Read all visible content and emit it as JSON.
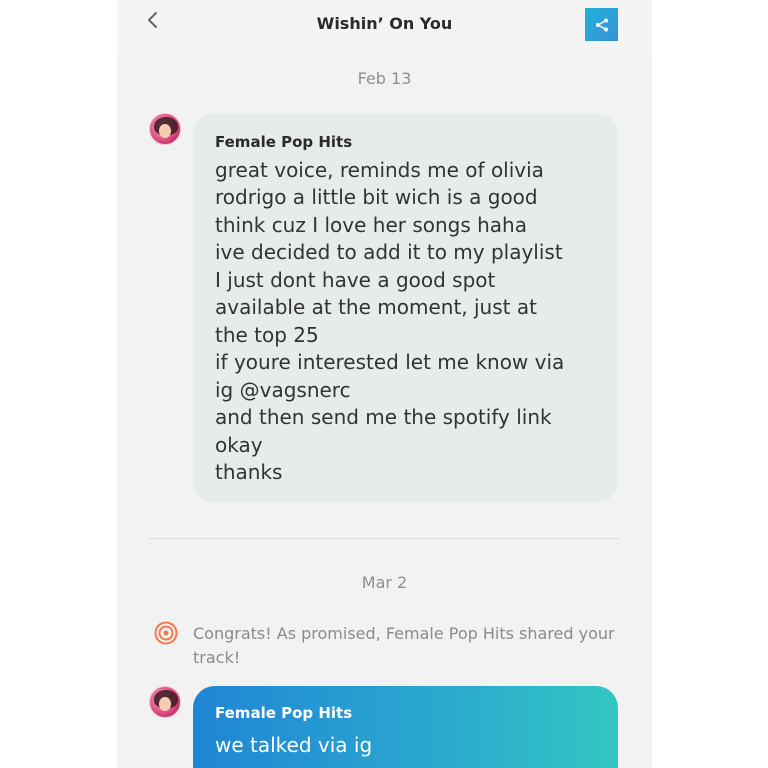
{
  "header": {
    "title": "Wishin’ On You"
  },
  "icons": {
    "back": "chevron-left-icon",
    "share": "share-icon",
    "congrats": "target-icon"
  },
  "colors": {
    "accent": "#2aa6cf",
    "share_button": "#2a9ed8",
    "congrats_icon": "#f07a4a"
  },
  "thread": {
    "date1": "Feb 13",
    "message1": {
      "sender": "Female Pop Hits",
      "lines": [
        "great voice, reminds me of olivia",
        "rodrigo a little bit wich is a good",
        "think cuz I love her songs haha",
        "ive decided to add it to my playlist",
        "I just dont have a good spot",
        "available at the moment, just at",
        "the top 25",
        "if youre interested let me know via",
        "ig @vagsnerc",
        "and then send me the spotify link",
        "okay",
        "thanks"
      ]
    },
    "date2": "Mar 2",
    "system_message": "Congrats! As promised, Female Pop Hits shared your track!",
    "message2": {
      "sender": "Female Pop Hits",
      "text": "we talked via ig"
    }
  }
}
